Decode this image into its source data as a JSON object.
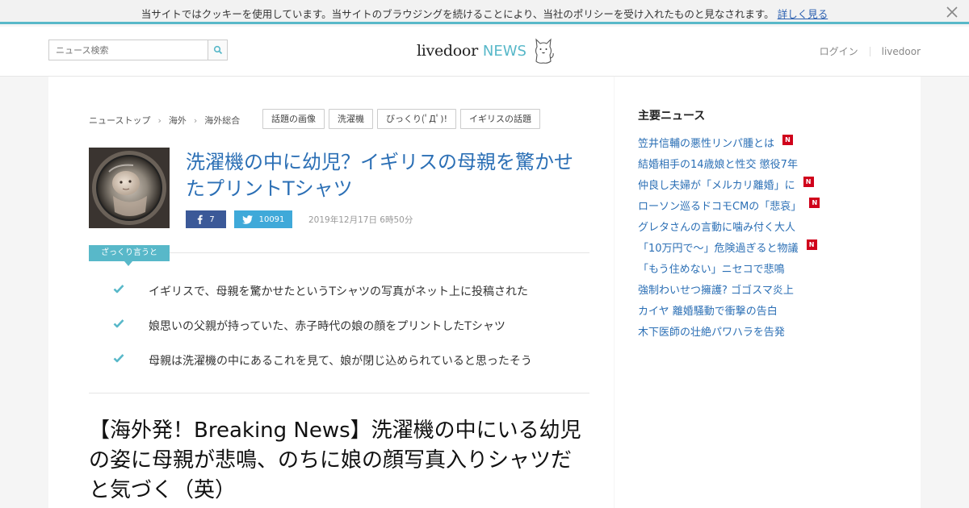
{
  "cookie_bar": {
    "message": "当サイトではクッキーを使用しています。当サイトのブラウジングを続けることにより、当社のポリシーを受け入れたものと見なされます。",
    "link": "詳しく見る"
  },
  "header": {
    "search_placeholder": "ニュース検索",
    "logo_livedoor": "livedoor",
    "logo_news": "NEWS",
    "login": "ログイン",
    "livedoor_link": "livedoor"
  },
  "breadcrumb": [
    "ニューストップ",
    "海外",
    "海外総合"
  ],
  "tags": [
    "話題の画像",
    "洗濯機",
    "びっくり(ﾟДﾟ)!",
    "イギリスの話題"
  ],
  "article": {
    "title": "洗濯機の中に幼児？イギリスの母親を驚かせたプリントTシャツ",
    "fb_count": "7",
    "tw_count": "10091",
    "date": "2019年12月17日 6時50分",
    "summary_label": "ざっくり言うと",
    "summary": [
      "イギリスで、母親を驚かせたというTシャツの写真がネット上に投稿された",
      "娘思いの父親が持っていた、赤子時代の娘の顔をプリントしたTシャツ",
      "母親は洗濯機の中にあるこれを見て、娘が閉じ込められていると思ったそう"
    ],
    "headline": "【海外発！Breaking News】洗濯機の中にいる幼児の姿に母親が悲鳴、のちに娘の顔写真入りシャツだと気づく（英）"
  },
  "sidebar": {
    "title": "主要ニュース",
    "items": [
      {
        "text": "笠井信輔の悪性リンパ腫とは",
        "new": true
      },
      {
        "text": "結婚相手の14歳娘と性交 懲役7年",
        "new": false
      },
      {
        "text": "仲良し夫婦が「メルカリ離婚」に",
        "new": true
      },
      {
        "text": "ローソン巡るドコモCMの「悲哀」",
        "new": true
      },
      {
        "text": "グレタさんの言動に噛み付く大人",
        "new": false
      },
      {
        "text": "「10万円で～」危険過ぎると物議",
        "new": true
      },
      {
        "text": "「もう住めない」ニセコで悲鳴",
        "new": false
      },
      {
        "text": "強制わいせつ擁護? ゴゴスマ炎上",
        "new": false
      },
      {
        "text": "カイヤ 離婚騒動で衝撃の告白",
        "new": false
      },
      {
        "text": "木下医師の壮絶パワハラを告発",
        "new": false
      }
    ],
    "badge_label": "N"
  },
  "colors": {
    "accent": "#58b8c9",
    "link": "#2b6fb5",
    "facebook": "#3b5998",
    "twitter": "#3fa9d9",
    "new_badge": "#d0021b"
  }
}
